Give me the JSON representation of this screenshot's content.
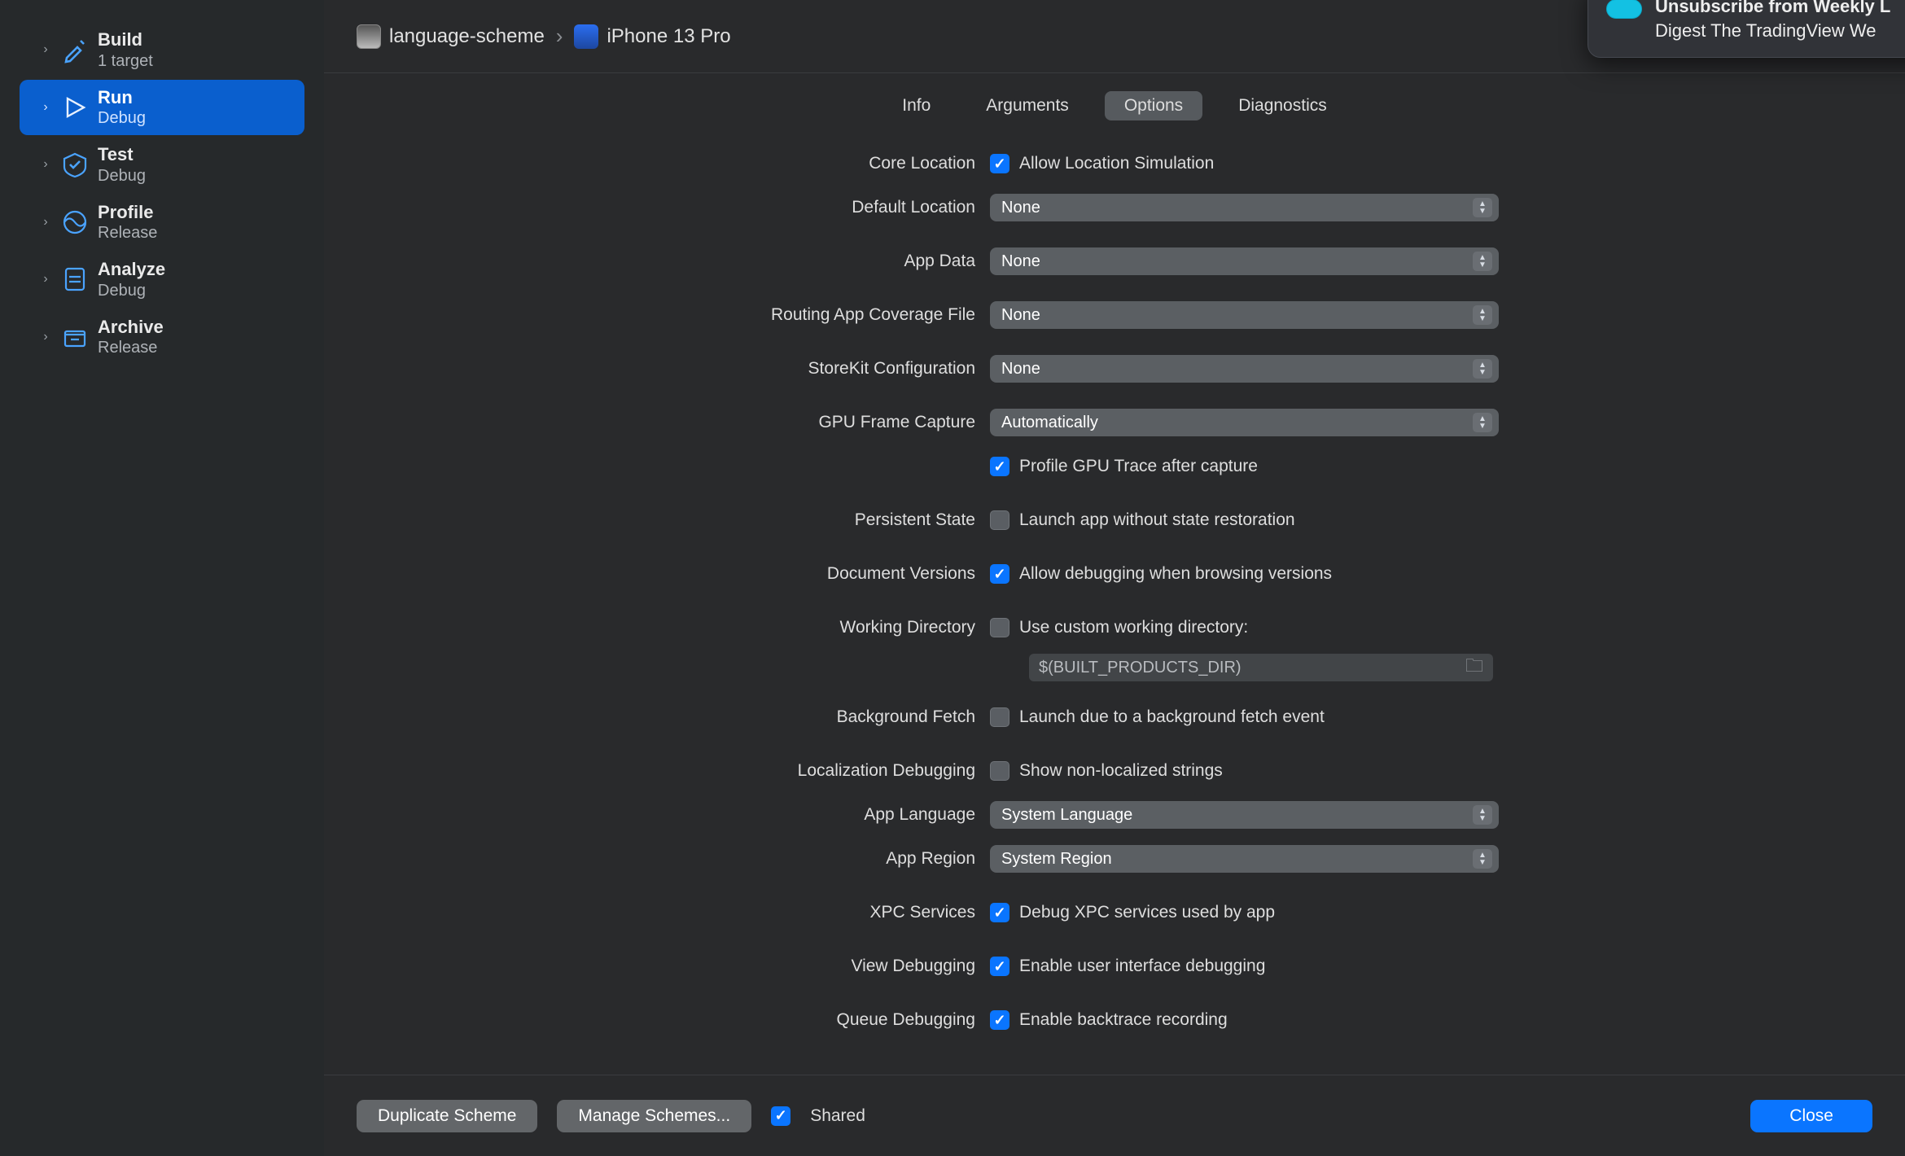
{
  "header": {
    "scheme": "language-scheme",
    "device": "iPhone 13 Pro"
  },
  "sidebar": {
    "items": [
      {
        "title": "Build",
        "sub": "1 target"
      },
      {
        "title": "Run",
        "sub": "Debug"
      },
      {
        "title": "Test",
        "sub": "Debug"
      },
      {
        "title": "Profile",
        "sub": "Release"
      },
      {
        "title": "Analyze",
        "sub": "Debug"
      },
      {
        "title": "Archive",
        "sub": "Release"
      }
    ]
  },
  "tabs": [
    "Info",
    "Arguments",
    "Options",
    "Diagnostics"
  ],
  "form": {
    "coreLocation": {
      "label": "Core Location",
      "check": "Allow Location Simulation"
    },
    "defaultLocation": {
      "label": "Default Location",
      "value": "None"
    },
    "appData": {
      "label": "App Data",
      "value": "None"
    },
    "routingFile": {
      "label": "Routing App Coverage File",
      "value": "None"
    },
    "storeKit": {
      "label": "StoreKit Configuration",
      "value": "None"
    },
    "gpuCapture": {
      "label": "GPU Frame Capture",
      "value": "Automatically",
      "check": "Profile GPU Trace after capture"
    },
    "persistentState": {
      "label": "Persistent State",
      "check": "Launch app without state restoration"
    },
    "documentVersions": {
      "label": "Document Versions",
      "check": "Allow debugging when browsing versions"
    },
    "workingDir": {
      "label": "Working Directory",
      "check": "Use custom working directory:",
      "placeholder": "$(BUILT_PRODUCTS_DIR)"
    },
    "backgroundFetch": {
      "label": "Background Fetch",
      "check": "Launch due to a background fetch event"
    },
    "locDebugging": {
      "label": "Localization Debugging",
      "check": "Show non-localized strings"
    },
    "appLanguage": {
      "label": "App Language",
      "value": "System Language"
    },
    "appRegion": {
      "label": "App Region",
      "value": "System Region"
    },
    "xpc": {
      "label": "XPC Services",
      "check": "Debug XPC services used by app"
    },
    "viewDebug": {
      "label": "View Debugging",
      "check": "Enable user interface debugging"
    },
    "queueDebug": {
      "label": "Queue Debugging",
      "check": "Enable backtrace recording"
    }
  },
  "footer": {
    "duplicate": "Duplicate Scheme",
    "manage": "Manage Schemes...",
    "shared": "Shared",
    "close": "Close"
  },
  "notification": {
    "line1": "Unsubscribe from Weekly L",
    "line2": "Digest The TradingView We"
  }
}
